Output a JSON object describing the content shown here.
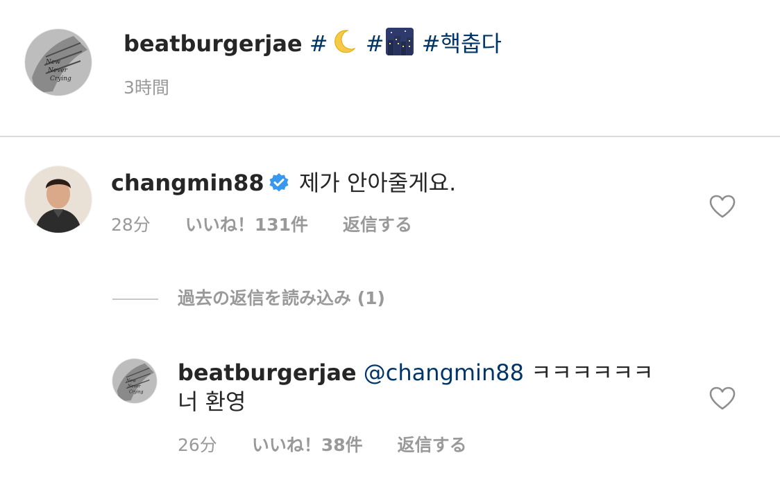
{
  "post": {
    "username": "beatburgerjae",
    "hashtag_prefix_1": "#",
    "emoji_1": "crescent-moon-emoji",
    "hashtag_prefix_2": "#",
    "emoji_2": "night-city-emoji",
    "hashtag_3": "#핵춥다",
    "time": "3時間"
  },
  "comment": {
    "username": "changmin88",
    "verified_icon": "verified-badge-icon",
    "text": "제가 안아줄게요.",
    "time": "28分",
    "likes": "いいね！131件",
    "reply": "返信する"
  },
  "view_replies": {
    "label": "過去の返信を読み込み (1)"
  },
  "reply": {
    "username": "beatburgerjae",
    "mention": "@changmin88",
    "text_line1": "ㅋㅋㅋㅋㅋㅋ",
    "text_line2": "너 환영",
    "time": "26分",
    "likes": "いいね！38件",
    "reply": "返信する"
  },
  "colors": {
    "hashtag": "#003569",
    "meta": "#999999",
    "verified": "#3897f0",
    "divider": "#dbdbdb"
  }
}
